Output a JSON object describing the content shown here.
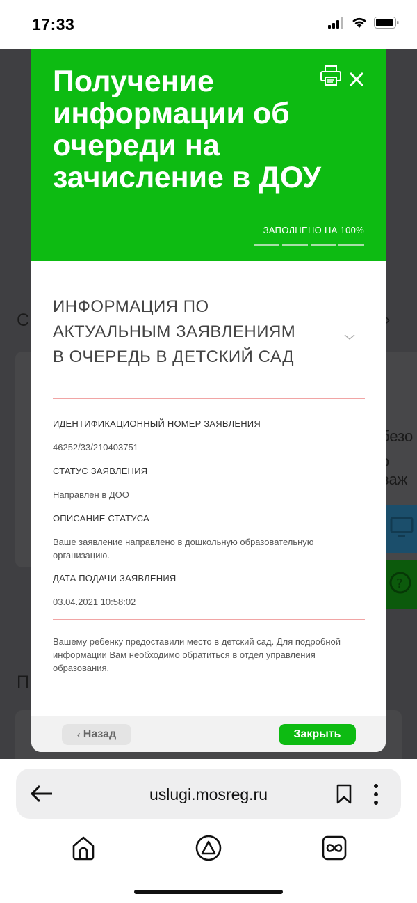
{
  "status_bar": {
    "time": "17:33"
  },
  "backdrop": {
    "fragments": [
      "С",
      "безо",
      "о важ",
      "П"
    ]
  },
  "modal": {
    "title": "Получение информации об очереди на зачисление в ДОУ",
    "progress_label": "ЗАПОЛНЕНО НА 100%",
    "progress_fraction": 1.0,
    "progress_segments": 4,
    "section_title": "ИНФОРМАЦИЯ ПО АКТУАЛЬНЫМ ЗАЯВЛЕНИЯМ В ОЧЕРЕДЬ В ДЕТСКИЙ САД",
    "fields": [
      {
        "label": "ИДЕНТИФИКАЦИОННЫЙ НОМЕР ЗАЯВЛЕНИЯ",
        "value": "46252/33/210403751"
      },
      {
        "label": "СТАТУС ЗАЯВЛЕНИЯ",
        "value": "Направлен в ДОО"
      },
      {
        "label": "ОПИСАНИЕ СТАТУСА",
        "value": "Ваше заявление направлено в дошкольную образовательную организацию."
      },
      {
        "label": "ДАТА ПОДАЧИ ЗАЯВЛЕНИЯ",
        "value": "03.04.2021 10:58:02"
      }
    ],
    "footer_note": "Вашему ребенку предоставили место в детский сад. Для подробной информации Вам необходимо обратиться в отдел управления образования.",
    "back_label": "Назад",
    "close_label": "Закрыть"
  },
  "browser": {
    "url": "uslugi.mosreg.ru"
  },
  "icons": {
    "print": "printer-icon",
    "close": "close-icon",
    "chevron": "chevron-down-icon",
    "back_arrow": "arrow-left-icon",
    "bookmark": "bookmark-icon",
    "menu": "more-vertical-icon",
    "home": "home-icon",
    "alice": "alice-icon",
    "tabs": "tabs-icon"
  },
  "colors": {
    "brand_green": "#0dbb12",
    "divider_red": "#f1a5a5",
    "backdrop": "#3f3f42"
  }
}
